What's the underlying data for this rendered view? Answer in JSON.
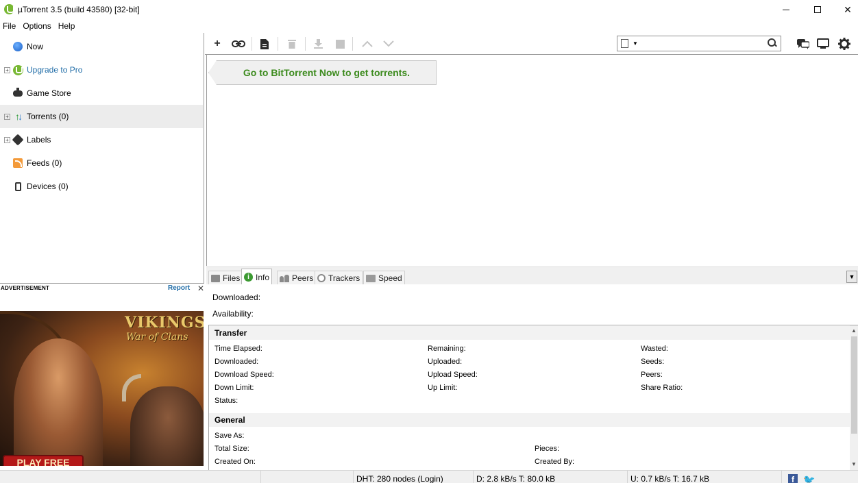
{
  "window": {
    "title": "µTorrent 3.5  (build 43580) [32-bit]",
    "controls": {
      "minimize": "minimize",
      "maximize": "maximize",
      "close": "✕"
    }
  },
  "menu": [
    "File",
    "Options",
    "Help"
  ],
  "sidebar": {
    "items": [
      {
        "label": "Now",
        "icon": "now-globe-icon",
        "expandable": false
      },
      {
        "label": "Upgrade to Pro",
        "icon": "utorrent-logo-icon",
        "expandable": true,
        "link": true
      },
      {
        "label": "Game Store",
        "icon": "gamepad-icon",
        "expandable": false
      },
      {
        "label": "Torrents (0)",
        "icon": "transfer-arrows-icon",
        "expandable": true,
        "selected": true
      },
      {
        "label": "Labels",
        "icon": "tag-icon",
        "expandable": true
      },
      {
        "label": "Feeds (0)",
        "icon": "rss-icon",
        "expandable": false
      },
      {
        "label": "Devices (0)",
        "icon": "phone-icon",
        "expandable": false
      }
    ]
  },
  "ad": {
    "label": "ADVERTISEMENT",
    "report": "Report",
    "close": "✕",
    "title_line1": "VIKINGS",
    "title_line2": "War of Clans",
    "cta": "PLAY  FREE"
  },
  "toolbar": {
    "buttons": [
      {
        "name": "add-torrent-button",
        "icon": "plus-icon",
        "enabled": true
      },
      {
        "name": "add-url-button",
        "icon": "link-icon",
        "enabled": true
      },
      {
        "name": "create-torrent-button",
        "icon": "new-file-icon",
        "enabled": true
      },
      {
        "name": "remove-button",
        "icon": "trash-icon",
        "enabled": false
      },
      {
        "name": "start-button",
        "icon": "download-icon",
        "enabled": false
      },
      {
        "name": "stop-button",
        "icon": "stop-icon",
        "enabled": false
      },
      {
        "name": "move-up-button",
        "icon": "chevron-up-icon",
        "enabled": false
      },
      {
        "name": "move-down-button",
        "icon": "chevron-down-icon",
        "enabled": false
      }
    ],
    "search_placeholder": "",
    "right_buttons": [
      "chat-icon",
      "remote-monitor-icon",
      "gear-icon"
    ]
  },
  "promo": {
    "text": "Go to BitTorrent Now to get torrents."
  },
  "tabs": [
    {
      "label": "Files",
      "icon": "files-icon",
      "active": false
    },
    {
      "label": "Info",
      "icon": "info-icon",
      "active": true
    },
    {
      "label": "Peers",
      "icon": "peers-icon",
      "active": false
    },
    {
      "label": "Trackers",
      "icon": "trackers-icon",
      "active": false
    },
    {
      "label": "Speed",
      "icon": "speed-chart-icon",
      "active": false
    }
  ],
  "info": {
    "downloaded": "Downloaded:",
    "availability": "Availability:",
    "transfer": {
      "heading": "Transfer",
      "col1": [
        "Time Elapsed:",
        "Downloaded:",
        "Download Speed:",
        "Down Limit:",
        "Status:"
      ],
      "col2": [
        "Remaining:",
        "Uploaded:",
        "Upload Speed:",
        "Up Limit:"
      ],
      "col3": [
        "Wasted:",
        "Seeds:",
        "Peers:",
        "Share Ratio:"
      ]
    },
    "general": {
      "heading": "General",
      "col1": [
        "Save As:",
        "Total Size:",
        "Created On:"
      ],
      "col2": [
        "Pieces:",
        "Created By:"
      ]
    }
  },
  "status": {
    "dht": "DHT: 280 nodes (Login)",
    "download": "D: 2.8 kB/s T: 80.0 kB",
    "upload": "U: 0.7 kB/s T: 16.7 kB"
  },
  "colors": {
    "accent_green": "#3b8a1c",
    "link_blue": "#226ea8",
    "selected_bg": "#ececec"
  }
}
